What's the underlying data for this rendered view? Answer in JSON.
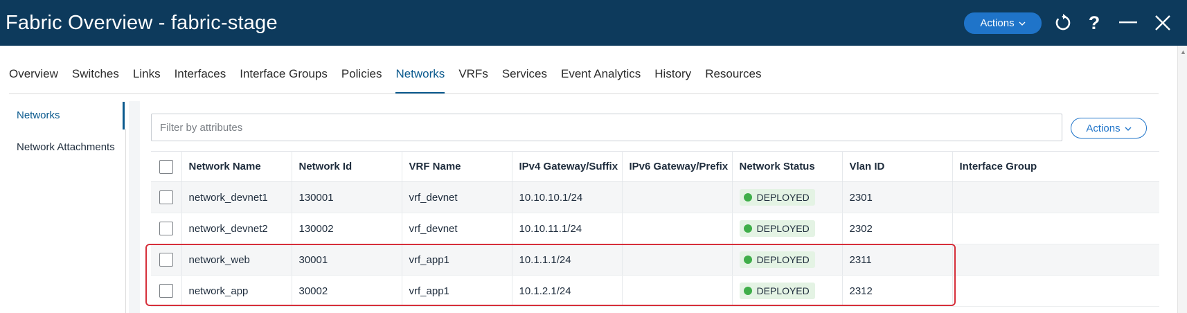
{
  "header": {
    "title": "Fabric Overview - fabric-stage",
    "actions_label": "Actions",
    "icons": [
      "refresh-icon",
      "help-icon",
      "minimize-icon",
      "close-icon"
    ]
  },
  "tabs": [
    {
      "label": "Overview",
      "active": false
    },
    {
      "label": "Switches",
      "active": false
    },
    {
      "label": "Links",
      "active": false
    },
    {
      "label": "Interfaces",
      "active": false
    },
    {
      "label": "Interface Groups",
      "active": false
    },
    {
      "label": "Policies",
      "active": false
    },
    {
      "label": "Networks",
      "active": true
    },
    {
      "label": "VRFs",
      "active": false
    },
    {
      "label": "Services",
      "active": false
    },
    {
      "label": "Event Analytics",
      "active": false
    },
    {
      "label": "History",
      "active": false
    },
    {
      "label": "Resources",
      "active": false
    }
  ],
  "sidenav": {
    "items": [
      {
        "label": "Networks",
        "active": true
      },
      {
        "label": "Network Attachments",
        "active": false
      }
    ]
  },
  "filter": {
    "placeholder": "Filter by attributes"
  },
  "content_actions_label": "Actions",
  "table": {
    "columns": [
      "Network Name",
      "Network Id",
      "VRF Name",
      "IPv4 Gateway/Suffix",
      "IPv6 Gateway/Prefix",
      "Network Status",
      "Vlan ID",
      "Interface Group"
    ],
    "rows": [
      {
        "name": "network_devnet1",
        "id": "130001",
        "vrf": "vrf_devnet",
        "ipv4": "10.10.10.1/24",
        "ipv6": "",
        "status": "DEPLOYED",
        "vlan": "2301",
        "group": ""
      },
      {
        "name": "network_devnet2",
        "id": "130002",
        "vrf": "vrf_devnet",
        "ipv4": "10.10.11.1/24",
        "ipv6": "",
        "status": "DEPLOYED",
        "vlan": "2302",
        "group": ""
      },
      {
        "name": "network_web",
        "id": "30001",
        "vrf": "vrf_app1",
        "ipv4": "10.1.1.1/24",
        "ipv6": "",
        "status": "DEPLOYED",
        "vlan": "2311",
        "group": ""
      },
      {
        "name": "network_app",
        "id": "30002",
        "vrf": "vrf_app1",
        "ipv4": "10.1.2.1/24",
        "ipv6": "",
        "status": "DEPLOYED",
        "vlan": "2312",
        "group": ""
      }
    ]
  },
  "colors": {
    "header_bg": "#0d3a5c",
    "accent": "#1f74c9",
    "active_tab": "#0b5a8e",
    "status_deployed": "#3fae49",
    "highlight": "#d62f3a"
  }
}
